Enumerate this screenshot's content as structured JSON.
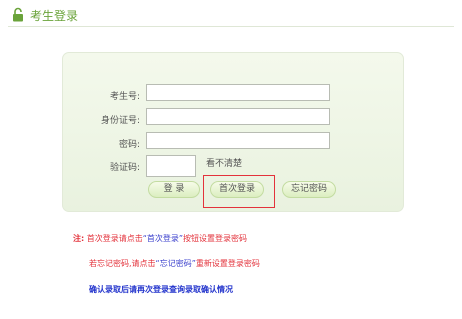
{
  "header": {
    "title": "考生登录",
    "icon": "lock-icon",
    "accent": "#6aa33a"
  },
  "form": {
    "exam_id_label": "考生号:",
    "id_card_label": "身份证号:",
    "password_label": "密码:",
    "captcha_label": "验证码:",
    "captcha_refresh": "看不清楚",
    "exam_id_value": "",
    "id_card_value": "",
    "password_value": "",
    "captcha_value": ""
  },
  "buttons": {
    "login": "登 录",
    "first_login": "首次登录",
    "forgot_password": "忘记密码"
  },
  "notes": {
    "prefix": "注:",
    "line1_a": "首次登录请点击",
    "line1_quote": "“首次登录”",
    "line1_b": "按钮设置登录密码",
    "line2_a": "若忘记密码,请点击",
    "line2_quote": "“忘记密码”",
    "line2_b": "重新设置登录密码",
    "line3": "确认录取后请再次登录查询录取确认情况"
  },
  "colors": {
    "note_red": "#e3323b",
    "note_blue": "#3a3fcc",
    "highlight_border": "#e3323b"
  }
}
